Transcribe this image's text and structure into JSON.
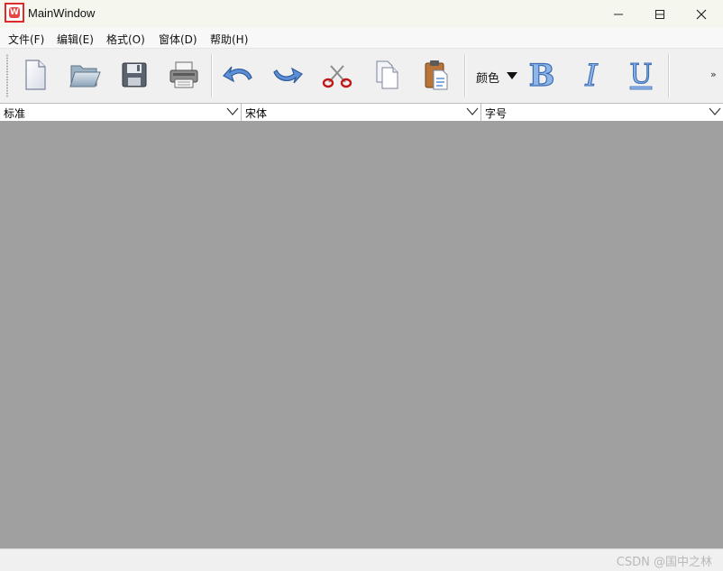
{
  "window": {
    "title": "MainWindow",
    "app_icon_letter": "W"
  },
  "menu": {
    "items": [
      {
        "label": "文件(F)"
      },
      {
        "label": "编辑(E)"
      },
      {
        "label": "格式(O)"
      },
      {
        "label": "窗体(D)"
      },
      {
        "label": "帮助(H)"
      }
    ]
  },
  "toolbar": {
    "color_label": "颜色",
    "overflow": "»",
    "icons": [
      "new-file-icon",
      "open-folder-icon",
      "save-disk-icon",
      "print-icon",
      "undo-icon",
      "redo-icon",
      "cut-scissors-icon",
      "copy-icon",
      "paste-icon",
      "bold-icon",
      "italic-icon",
      "underline-icon"
    ]
  },
  "combos": {
    "style": "标准",
    "font": "宋体",
    "size": "字号"
  },
  "statusbar": {
    "watermark": "CSDN @国中之林"
  },
  "colors": {
    "mdi_background": "#a0a0a0",
    "title_bar": "#f5f7ee",
    "accent_red": "#e02a2a"
  }
}
